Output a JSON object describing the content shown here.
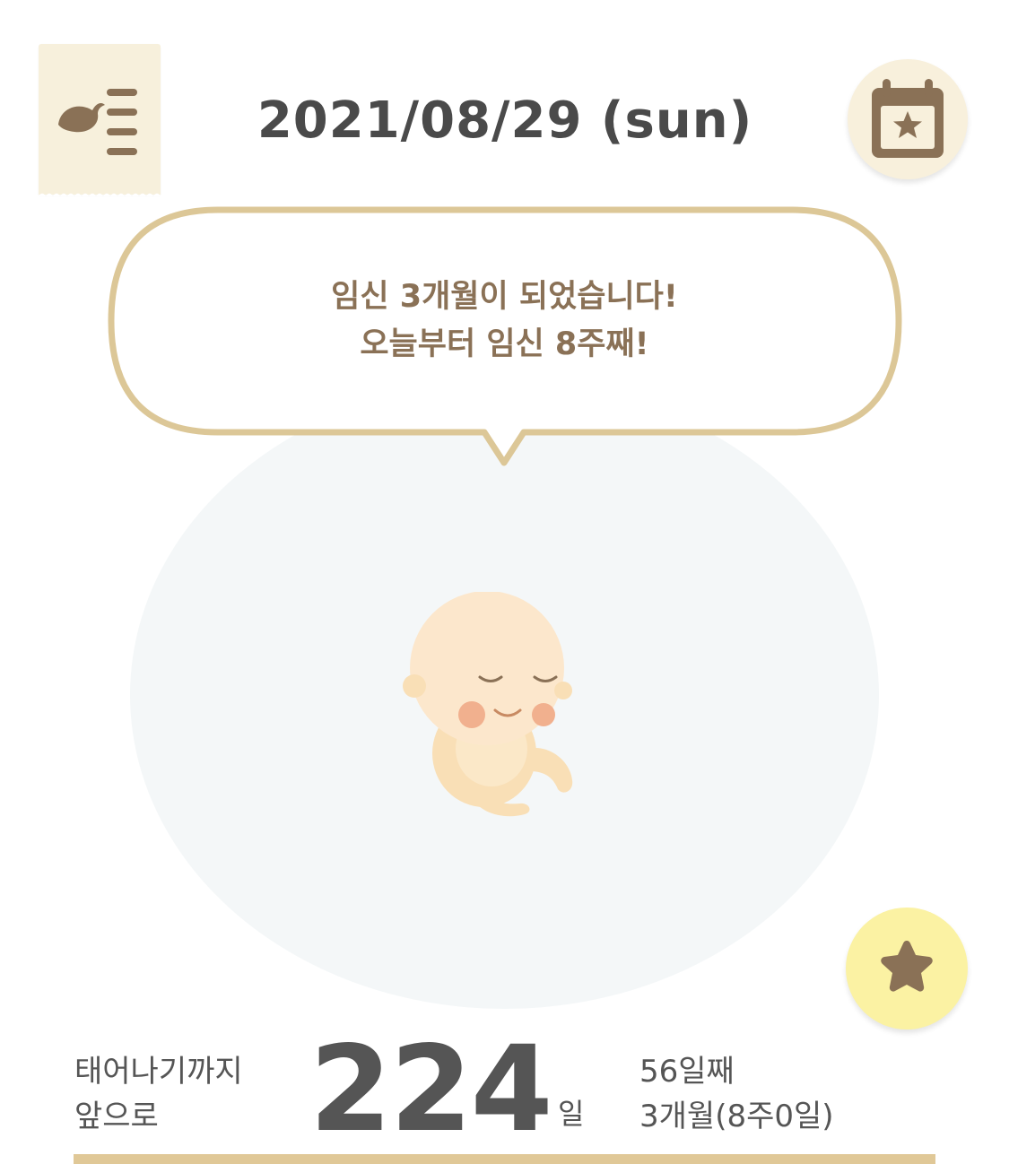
{
  "header": {
    "date": "2021/08/29 (sun)"
  },
  "bubble": {
    "line1": "임신 3개월이 되었습니다!",
    "line2": "오늘부터 임신 8주째!"
  },
  "countdown": {
    "label_line1": "태어나기까지",
    "label_line2": "앞으로",
    "days": "224",
    "unit": "일"
  },
  "progress": {
    "day_count": "56일째",
    "month_week": "3개월(8주0일)"
  },
  "icons": {
    "menu": "bird-menu-icon",
    "calendar": "calendar-star-icon",
    "favorite": "star-icon"
  },
  "colors": {
    "accent_brown": "#8a7156",
    "bubble_border": "#dcc797",
    "calendar_bg": "#f8f0dc",
    "favorite_bg": "#fbf2a3",
    "progress_bar": "#e0c897"
  }
}
